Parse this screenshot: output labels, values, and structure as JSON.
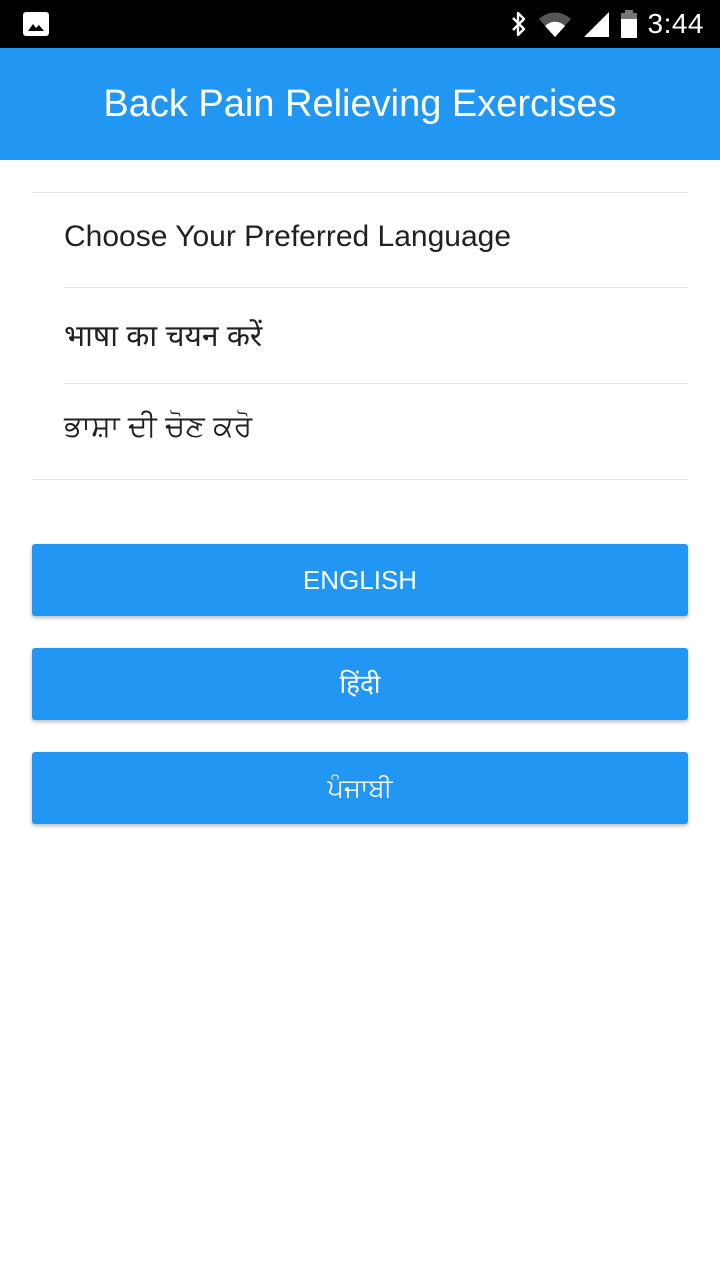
{
  "status_bar": {
    "notification_icons": [
      "gallery-icon"
    ],
    "system_icons": [
      "bluetooth-icon",
      "wifi-icon",
      "cell-signal-icon",
      "battery-icon"
    ],
    "time": "3:44"
  },
  "app_bar": {
    "title": "Back Pain Relieving Exercises",
    "color": "#2196F3"
  },
  "prompts": [
    {
      "lang": "English",
      "text": "Choose Your Preferred Language"
    },
    {
      "lang": "Hindi",
      "text": "भाषा का चयन करें"
    },
    {
      "lang": "Punjabi",
      "text": "ਭਾਸ਼ਾ ਦੀ ਚੋਣ ਕਰੋ"
    }
  ],
  "language_buttons": [
    {
      "label": "ENGLISH"
    },
    {
      "label": "हिंदी"
    },
    {
      "label": "ਪੰਜਾਬੀ"
    }
  ]
}
